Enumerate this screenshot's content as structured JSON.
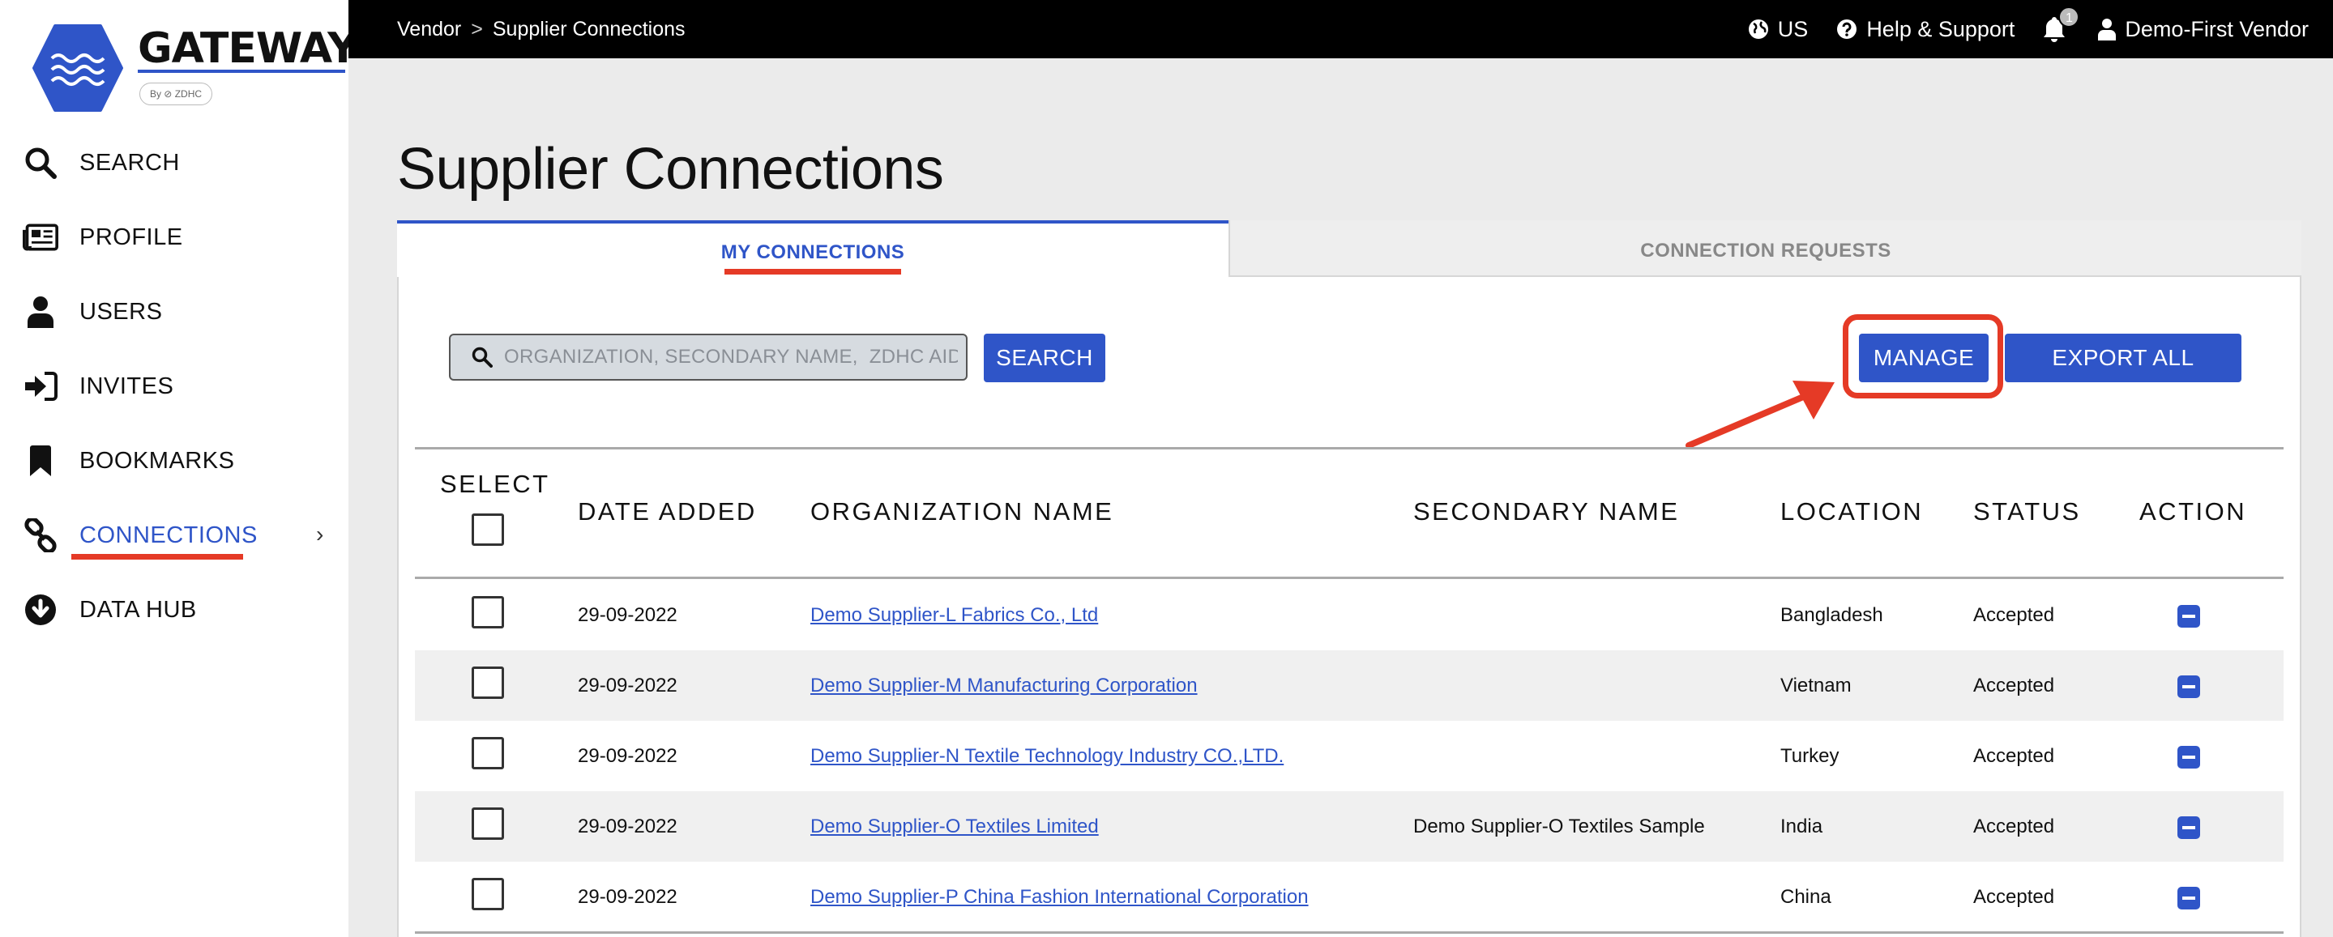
{
  "brand": {
    "name": "GATEWAY",
    "sub": "By ⊘ ZDHC",
    "accent_color": "#2f55c8",
    "highlight_color": "#e53a26"
  },
  "sidebar": {
    "items": [
      {
        "label": "SEARCH",
        "icon": "search-icon"
      },
      {
        "label": "PROFILE",
        "icon": "newspaper-icon"
      },
      {
        "label": "USERS",
        "icon": "user-icon"
      },
      {
        "label": "INVITES",
        "icon": "sign-in-icon"
      },
      {
        "label": "BOOKMARKS",
        "icon": "bookmark-icon"
      },
      {
        "label": "CONNECTIONS",
        "icon": "link-icon",
        "active": true
      },
      {
        "label": "DATA HUB",
        "icon": "download-circle-icon"
      }
    ],
    "chevron": "›"
  },
  "topbar": {
    "breadcrumb": [
      "Vendor",
      "Supplier Connections"
    ],
    "breadcrumb_sep": ">",
    "region": "US",
    "help": "Help & Support",
    "notifications": "1",
    "user": "Demo-First Vendor"
  },
  "main": {
    "title": "Supplier Connections",
    "tabs": [
      {
        "label": "MY CONNECTIONS",
        "active": true
      },
      {
        "label": "CONNECTION REQUESTS",
        "active": false
      }
    ],
    "search": {
      "placeholder": "ORGANIZATION, SECONDARY NAME,  ZDHC AID",
      "value": "",
      "button": "SEARCH"
    },
    "manage_button": "MANAGE",
    "export_button": "EXPORT ALL"
  },
  "table": {
    "columns": {
      "select": "SELECT",
      "date": "DATE ADDED",
      "org": "ORGANIZATION NAME",
      "secondary": "SECONDARY NAME",
      "location": "LOCATION",
      "status": "STATUS",
      "action": "ACTION"
    },
    "rows": [
      {
        "date": "29-09-2022",
        "org": "Demo Supplier-L Fabrics Co., Ltd",
        "secondary": "",
        "location": "Bangladesh",
        "status": "Accepted"
      },
      {
        "date": "29-09-2022",
        "org": "Demo Supplier-M Manufacturing Corporation",
        "secondary": "",
        "location": "Vietnam",
        "status": "Accepted"
      },
      {
        "date": "29-09-2022",
        "org": "Demo Supplier-N Textile Technology Industry CO.,LTD.",
        "secondary": "",
        "location": "Turkey",
        "status": "Accepted"
      },
      {
        "date": "29-09-2022",
        "org": "Demo Supplier-O Textiles Limited",
        "secondary": "Demo Supplier-O Textiles Sample",
        "location": "India",
        "status": "Accepted"
      },
      {
        "date": "29-09-2022",
        "org": "Demo Supplier-P China Fashion International Corporation",
        "secondary": "",
        "location": "China",
        "status": "Accepted"
      }
    ]
  }
}
